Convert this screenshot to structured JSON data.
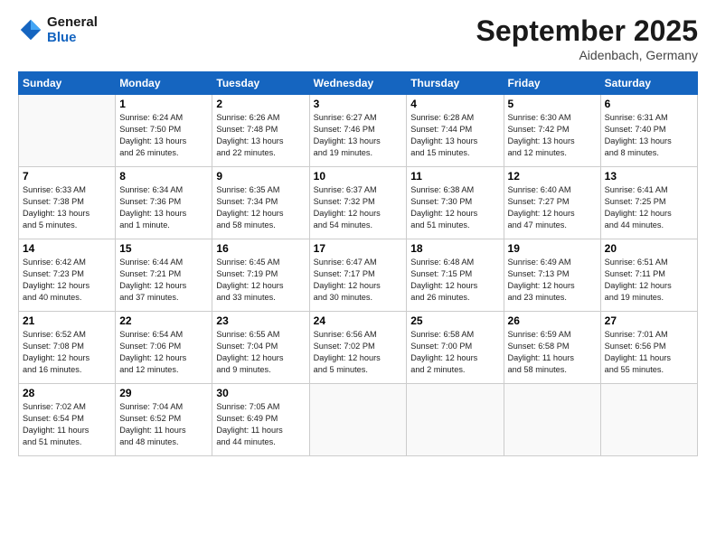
{
  "logo": {
    "line1": "General",
    "line2": "Blue"
  },
  "title": "September 2025",
  "location": "Aidenbach, Germany",
  "days_of_week": [
    "Sunday",
    "Monday",
    "Tuesday",
    "Wednesday",
    "Thursday",
    "Friday",
    "Saturday"
  ],
  "weeks": [
    [
      {
        "day": "",
        "info": ""
      },
      {
        "day": "1",
        "info": "Sunrise: 6:24 AM\nSunset: 7:50 PM\nDaylight: 13 hours\nand 26 minutes."
      },
      {
        "day": "2",
        "info": "Sunrise: 6:26 AM\nSunset: 7:48 PM\nDaylight: 13 hours\nand 22 minutes."
      },
      {
        "day": "3",
        "info": "Sunrise: 6:27 AM\nSunset: 7:46 PM\nDaylight: 13 hours\nand 19 minutes."
      },
      {
        "day": "4",
        "info": "Sunrise: 6:28 AM\nSunset: 7:44 PM\nDaylight: 13 hours\nand 15 minutes."
      },
      {
        "day": "5",
        "info": "Sunrise: 6:30 AM\nSunset: 7:42 PM\nDaylight: 13 hours\nand 12 minutes."
      },
      {
        "day": "6",
        "info": "Sunrise: 6:31 AM\nSunset: 7:40 PM\nDaylight: 13 hours\nand 8 minutes."
      }
    ],
    [
      {
        "day": "7",
        "info": "Sunrise: 6:33 AM\nSunset: 7:38 PM\nDaylight: 13 hours\nand 5 minutes."
      },
      {
        "day": "8",
        "info": "Sunrise: 6:34 AM\nSunset: 7:36 PM\nDaylight: 13 hours\nand 1 minute."
      },
      {
        "day": "9",
        "info": "Sunrise: 6:35 AM\nSunset: 7:34 PM\nDaylight: 12 hours\nand 58 minutes."
      },
      {
        "day": "10",
        "info": "Sunrise: 6:37 AM\nSunset: 7:32 PM\nDaylight: 12 hours\nand 54 minutes."
      },
      {
        "day": "11",
        "info": "Sunrise: 6:38 AM\nSunset: 7:30 PM\nDaylight: 12 hours\nand 51 minutes."
      },
      {
        "day": "12",
        "info": "Sunrise: 6:40 AM\nSunset: 7:27 PM\nDaylight: 12 hours\nand 47 minutes."
      },
      {
        "day": "13",
        "info": "Sunrise: 6:41 AM\nSunset: 7:25 PM\nDaylight: 12 hours\nand 44 minutes."
      }
    ],
    [
      {
        "day": "14",
        "info": "Sunrise: 6:42 AM\nSunset: 7:23 PM\nDaylight: 12 hours\nand 40 minutes."
      },
      {
        "day": "15",
        "info": "Sunrise: 6:44 AM\nSunset: 7:21 PM\nDaylight: 12 hours\nand 37 minutes."
      },
      {
        "day": "16",
        "info": "Sunrise: 6:45 AM\nSunset: 7:19 PM\nDaylight: 12 hours\nand 33 minutes."
      },
      {
        "day": "17",
        "info": "Sunrise: 6:47 AM\nSunset: 7:17 PM\nDaylight: 12 hours\nand 30 minutes."
      },
      {
        "day": "18",
        "info": "Sunrise: 6:48 AM\nSunset: 7:15 PM\nDaylight: 12 hours\nand 26 minutes."
      },
      {
        "day": "19",
        "info": "Sunrise: 6:49 AM\nSunset: 7:13 PM\nDaylight: 12 hours\nand 23 minutes."
      },
      {
        "day": "20",
        "info": "Sunrise: 6:51 AM\nSunset: 7:11 PM\nDaylight: 12 hours\nand 19 minutes."
      }
    ],
    [
      {
        "day": "21",
        "info": "Sunrise: 6:52 AM\nSunset: 7:08 PM\nDaylight: 12 hours\nand 16 minutes."
      },
      {
        "day": "22",
        "info": "Sunrise: 6:54 AM\nSunset: 7:06 PM\nDaylight: 12 hours\nand 12 minutes."
      },
      {
        "day": "23",
        "info": "Sunrise: 6:55 AM\nSunset: 7:04 PM\nDaylight: 12 hours\nand 9 minutes."
      },
      {
        "day": "24",
        "info": "Sunrise: 6:56 AM\nSunset: 7:02 PM\nDaylight: 12 hours\nand 5 minutes."
      },
      {
        "day": "25",
        "info": "Sunrise: 6:58 AM\nSunset: 7:00 PM\nDaylight: 12 hours\nand 2 minutes."
      },
      {
        "day": "26",
        "info": "Sunrise: 6:59 AM\nSunset: 6:58 PM\nDaylight: 11 hours\nand 58 minutes."
      },
      {
        "day": "27",
        "info": "Sunrise: 7:01 AM\nSunset: 6:56 PM\nDaylight: 11 hours\nand 55 minutes."
      }
    ],
    [
      {
        "day": "28",
        "info": "Sunrise: 7:02 AM\nSunset: 6:54 PM\nDaylight: 11 hours\nand 51 minutes."
      },
      {
        "day": "29",
        "info": "Sunrise: 7:04 AM\nSunset: 6:52 PM\nDaylight: 11 hours\nand 48 minutes."
      },
      {
        "day": "30",
        "info": "Sunrise: 7:05 AM\nSunset: 6:49 PM\nDaylight: 11 hours\nand 44 minutes."
      },
      {
        "day": "",
        "info": ""
      },
      {
        "day": "",
        "info": ""
      },
      {
        "day": "",
        "info": ""
      },
      {
        "day": "",
        "info": ""
      }
    ]
  ]
}
